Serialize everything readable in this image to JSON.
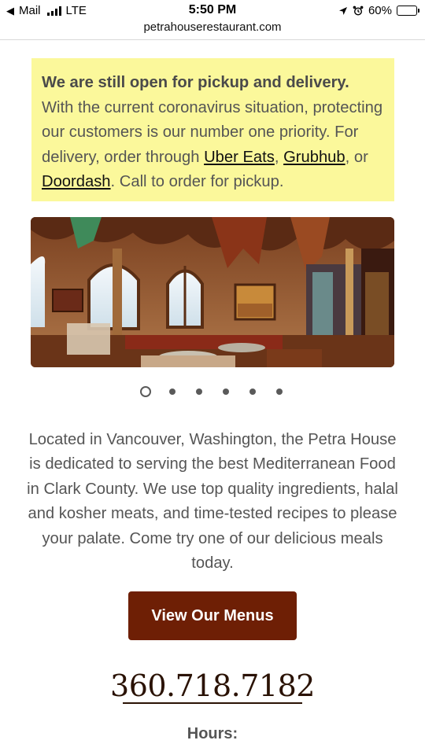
{
  "status_bar": {
    "back_app": "Mail",
    "network": "LTE",
    "time": "5:50 PM",
    "battery": "60%",
    "battery_level": 0.6
  },
  "browser": {
    "url": "petrahouserestaurant.com"
  },
  "notice": {
    "headline": "We are still open for pickup and delivery.",
    "text_before": " With the current coronavirus situation, protecting our customers is our number one priority. For delivery, order through ",
    "link_ubereats": "Uber Eats",
    "sep1": ", ",
    "link_grubhub": "Grubhub",
    "sep2": ", or ",
    "link_doordash": "Doordash",
    "text_after": ". Call to order for pickup."
  },
  "carousel": {
    "slide_count": 6,
    "active_index": 0
  },
  "about": "Located in Vancouver, Washington, the Petra House is dedicated to serving the best Mediterranean Food in Clark County. We use top quality ingredients, halal and kosher meats, and time-tested recipes to please your palate. Come try one of our delicious meals today.",
  "menu_button": "View Our Menus",
  "phone": "360.718.7182",
  "hours_heading": "Hours:",
  "colors": {
    "notice_bg": "#fbf89b",
    "button_bg": "#6e1f05",
    "phone_text": "#2a1204"
  }
}
